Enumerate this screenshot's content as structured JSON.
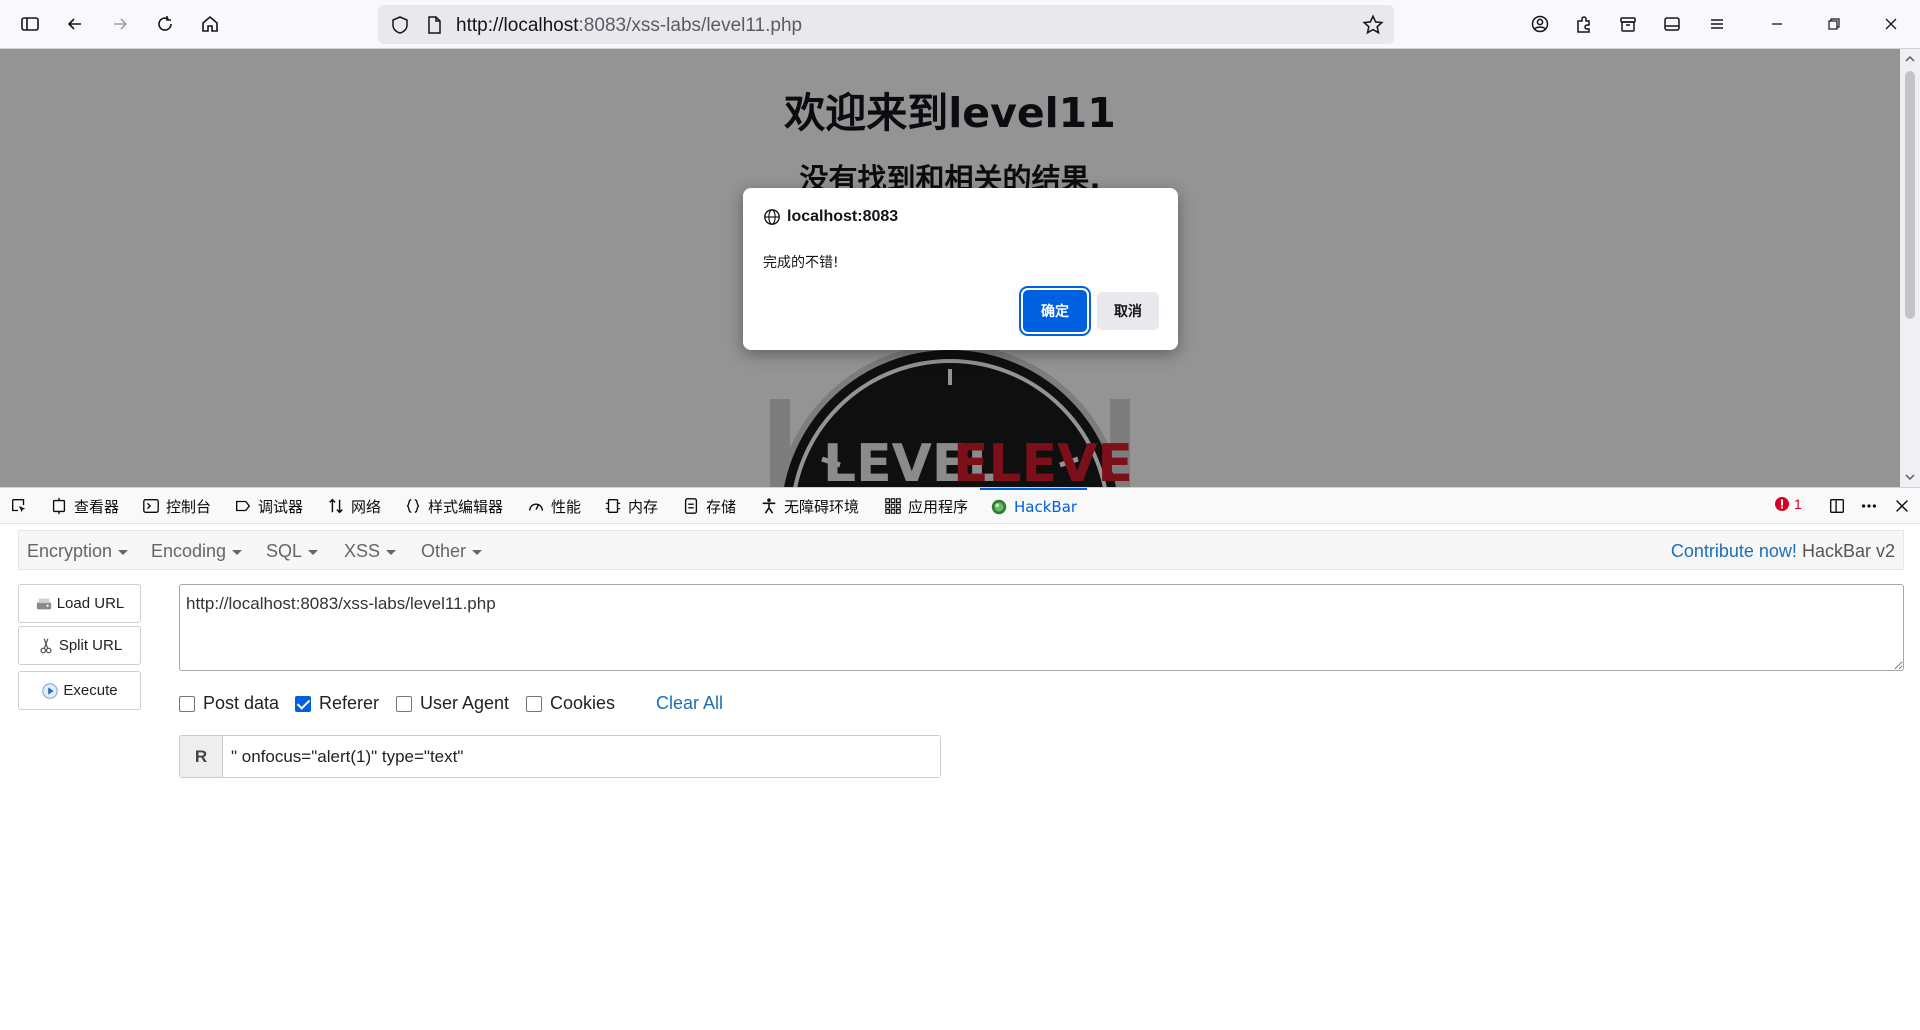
{
  "browser": {
    "url_host": "http://localhost",
    "url_rest": ":8083/xss-labs/level11.php"
  },
  "page": {
    "heading": "欢迎来到level11",
    "subheading": "没有找到和相关的结果.",
    "logo_text_left": "LEVEL",
    "logo_text_right": "ELEVEN"
  },
  "dialog": {
    "origin": "localhost:8083",
    "message": "完成的不错!",
    "ok_label": "确定",
    "cancel_label": "取消"
  },
  "devtools": {
    "tabs": [
      {
        "label": "查看器",
        "icon": "inspector-icon"
      },
      {
        "label": "控制台",
        "icon": "console-icon"
      },
      {
        "label": "调试器",
        "icon": "debugger-icon"
      },
      {
        "label": "网络",
        "icon": "network-icon"
      },
      {
        "label": "样式编辑器",
        "icon": "style-editor-icon"
      },
      {
        "label": "性能",
        "icon": "performance-icon"
      },
      {
        "label": "内存",
        "icon": "memory-icon"
      },
      {
        "label": "存储",
        "icon": "storage-icon"
      },
      {
        "label": "无障碍环境",
        "icon": "accessibility-icon"
      },
      {
        "label": "应用程序",
        "icon": "application-icon"
      },
      {
        "label": "HackBar",
        "icon": "hackbar-icon"
      }
    ],
    "error_count": "1"
  },
  "hackbar": {
    "menu": {
      "encryption": "Encryption",
      "encoding": "Encoding",
      "sql": "SQL",
      "xss": "XSS",
      "other": "Other"
    },
    "contribute": "Contribute now!",
    "version": "HackBar v2",
    "buttons": {
      "load": "Load URL",
      "split": "Split URL",
      "execute": "Execute"
    },
    "url_value": "http://localhost:8083/xss-labs/level11.php",
    "checks": {
      "post": "Post data",
      "referer": "Referer",
      "user_agent": "User Agent",
      "cookies": "Cookies"
    },
    "clear_all": "Clear All",
    "referer_label": "R",
    "referer_value": "\" onfocus=\"alert(1)\" type=\"text\""
  }
}
